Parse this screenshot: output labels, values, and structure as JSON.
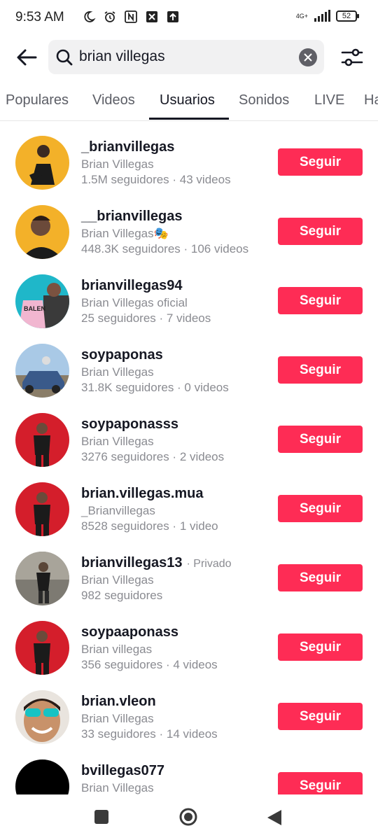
{
  "status_bar": {
    "time": "9:53 AM",
    "network": "4G+",
    "battery": "52"
  },
  "search": {
    "value": "brian villegas",
    "placeholder": ""
  },
  "tabs": [
    {
      "label": "Populares",
      "active": false
    },
    {
      "label": "Videos",
      "active": false
    },
    {
      "label": "Usuarios",
      "active": true
    },
    {
      "label": "Sonidos",
      "active": false
    },
    {
      "label": "LIVE",
      "active": false
    },
    {
      "label": "Ha",
      "active": false
    }
  ],
  "follow_label": "Seguir",
  "users": [
    {
      "username": "_brianvillegas",
      "display_name": "Brian Villegas",
      "stats": "1.5M seguidores · 43 videos",
      "private": ""
    },
    {
      "username": "__brianvillegas",
      "display_name": "Brian Villegas🎭",
      "stats": "448.3K seguidores · 106 videos",
      "private": ""
    },
    {
      "username": "brianvillegas94",
      "display_name": "Brian Villegas oficial",
      "stats": "25 seguidores · 7 videos",
      "private": ""
    },
    {
      "username": "soypaponas",
      "display_name": "Brian Villegas",
      "stats": "31.8K seguidores · 0 videos",
      "private": ""
    },
    {
      "username": "soypaponasss",
      "display_name": "Brian Villegas",
      "stats": "3276 seguidores · 2 videos",
      "private": ""
    },
    {
      "username": "brian.villegas.mua",
      "display_name": "_Brianvillegas",
      "stats": "8528 seguidores · 1 video",
      "private": ""
    },
    {
      "username": "brianvillegas13",
      "display_name": "Brian Villegas",
      "stats": "982 seguidores",
      "private": "· Privado"
    },
    {
      "username": "soypaaponass",
      "display_name": "Brian villegas",
      "stats": "356 seguidores · 4 videos",
      "private": ""
    },
    {
      "username": "brian.vleon",
      "display_name": "Brian Villegas",
      "stats": "33 seguidores · 14 videos",
      "private": ""
    },
    {
      "username": "bvillegas077",
      "display_name": "Brian Villegas",
      "stats": "",
      "private": ""
    }
  ],
  "colors": {
    "accent": "#fe2c55",
    "text_primary": "#161823",
    "text_secondary": "#8a8b91"
  }
}
